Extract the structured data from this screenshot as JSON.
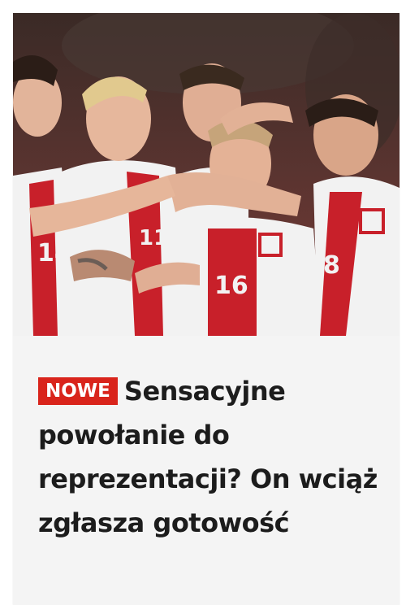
{
  "article": {
    "badge": "NOWE",
    "title": "Sensacyjne powołanie do reprezentacji? On wciąż zgłasza gotowość",
    "image": {
      "subject": "polish-national-team-players-celebrating",
      "jersey_numbers": [
        "14",
        "11",
        "16",
        "8"
      ]
    }
  },
  "colors": {
    "badge_bg": "#d9241b",
    "badge_text": "#ffffff",
    "title": "#1c1c1c",
    "card_bg": "#f4f4f4",
    "jersey_red": "#c8202a",
    "jersey_white": "#f2f2f2"
  }
}
